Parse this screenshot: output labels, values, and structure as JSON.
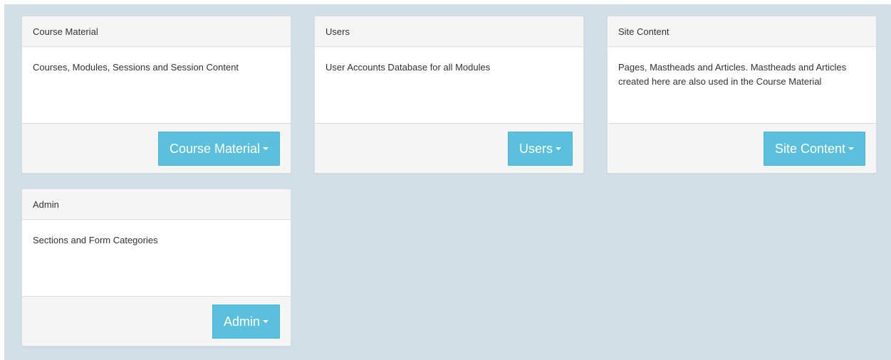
{
  "cards": [
    {
      "title": "Course Material",
      "description": "Courses, Modules, Sessions and Session Content",
      "button_label": "Course Material"
    },
    {
      "title": "Users",
      "description": "User Accounts Database for all Modules",
      "button_label": "Users"
    },
    {
      "title": "Site Content",
      "description": "Pages, Mastheads and Articles. Mastheads and Articles created here are also used in the Course Material",
      "button_label": "Site Content"
    },
    {
      "title": "Admin",
      "description": "Sections and Form Categories",
      "button_label": "Admin"
    }
  ],
  "colors": {
    "background": "#d1e0e7",
    "button": "#5bc0de",
    "panel_header": "#f5f5f5"
  },
  "icons": {
    "dropdown": "caret-down-icon"
  }
}
